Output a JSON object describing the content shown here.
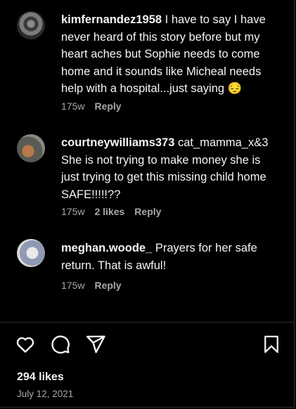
{
  "comments": [
    {
      "username": "kimfernandez1958",
      "text": " I have to say I have never heard of this story before but my heart aches but Sophie needs to come home and it sounds like Micheal needs help with a hospital...just saying 😔",
      "age": "175w",
      "likes": "",
      "reply_label": "Reply"
    },
    {
      "username": "courtneywilliams373",
      "text": " cat_mamma_x&3 She is not trying to make money she is just trying to get this missing child home SAFE!!!!!??",
      "age": "175w",
      "likes": "2 likes",
      "reply_label": "Reply"
    },
    {
      "username": "meghan.woode_",
      "text": "  Prayers for her safe return. That is awful!",
      "age": "175w",
      "likes": "",
      "reply_label": "Reply"
    }
  ],
  "actions": {
    "like_icon": "heart-icon",
    "comment_icon": "comment-icon",
    "share_icon": "share-icon",
    "save_icon": "bookmark-icon"
  },
  "post": {
    "likes": "294 likes",
    "date": "July 12, 2021"
  }
}
